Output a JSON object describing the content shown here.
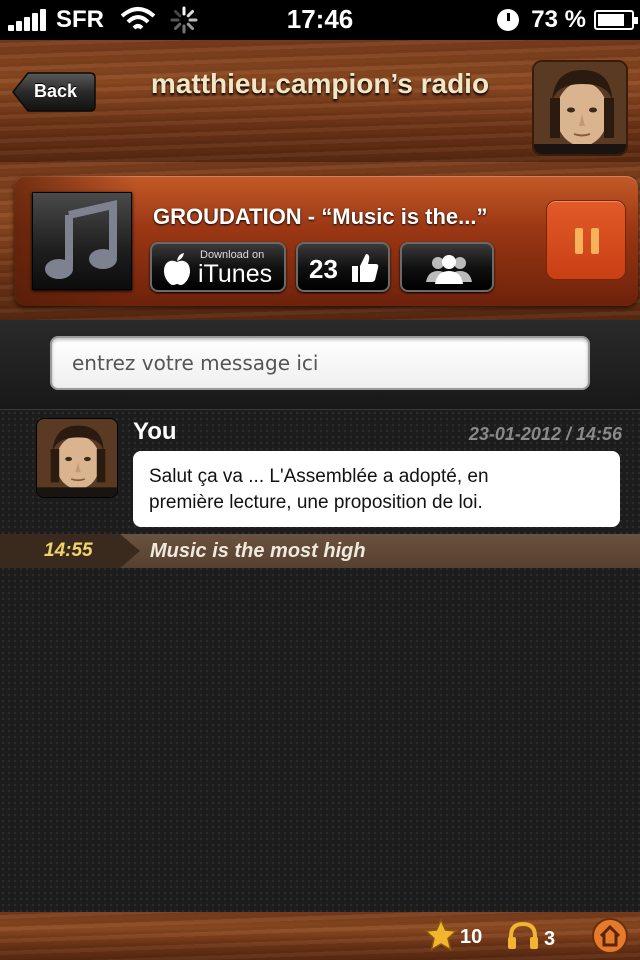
{
  "statusbar": {
    "carrier": "SFR",
    "time": "17:46",
    "battery": "73 %"
  },
  "navbar": {
    "back_label": "Back",
    "title": "matthieu.campion’s radio"
  },
  "player": {
    "song_title": "GROUDATION  - “Music is the...”",
    "itunes_small": "Download on",
    "itunes_big": "iTunes",
    "like_count": "23",
    "state": "playing"
  },
  "composer": {
    "placeholder": "entrez votre message ici"
  },
  "messages": [
    {
      "author": "You",
      "date": "23-01-2012 / 14:56",
      "text_line1": "Salut ça va ... L'Assemblée a adopté, en",
      "text_line2": "première lecture, une proposition de loi."
    }
  ],
  "track_event": {
    "time": "14:55",
    "title": "Music is the most high"
  },
  "bottombar": {
    "stars": "10",
    "listeners": "3"
  },
  "colors": {
    "accent_orange": "#e25a28",
    "title_cream": "#f3e6c6",
    "time_gold": "#f1d36c"
  }
}
